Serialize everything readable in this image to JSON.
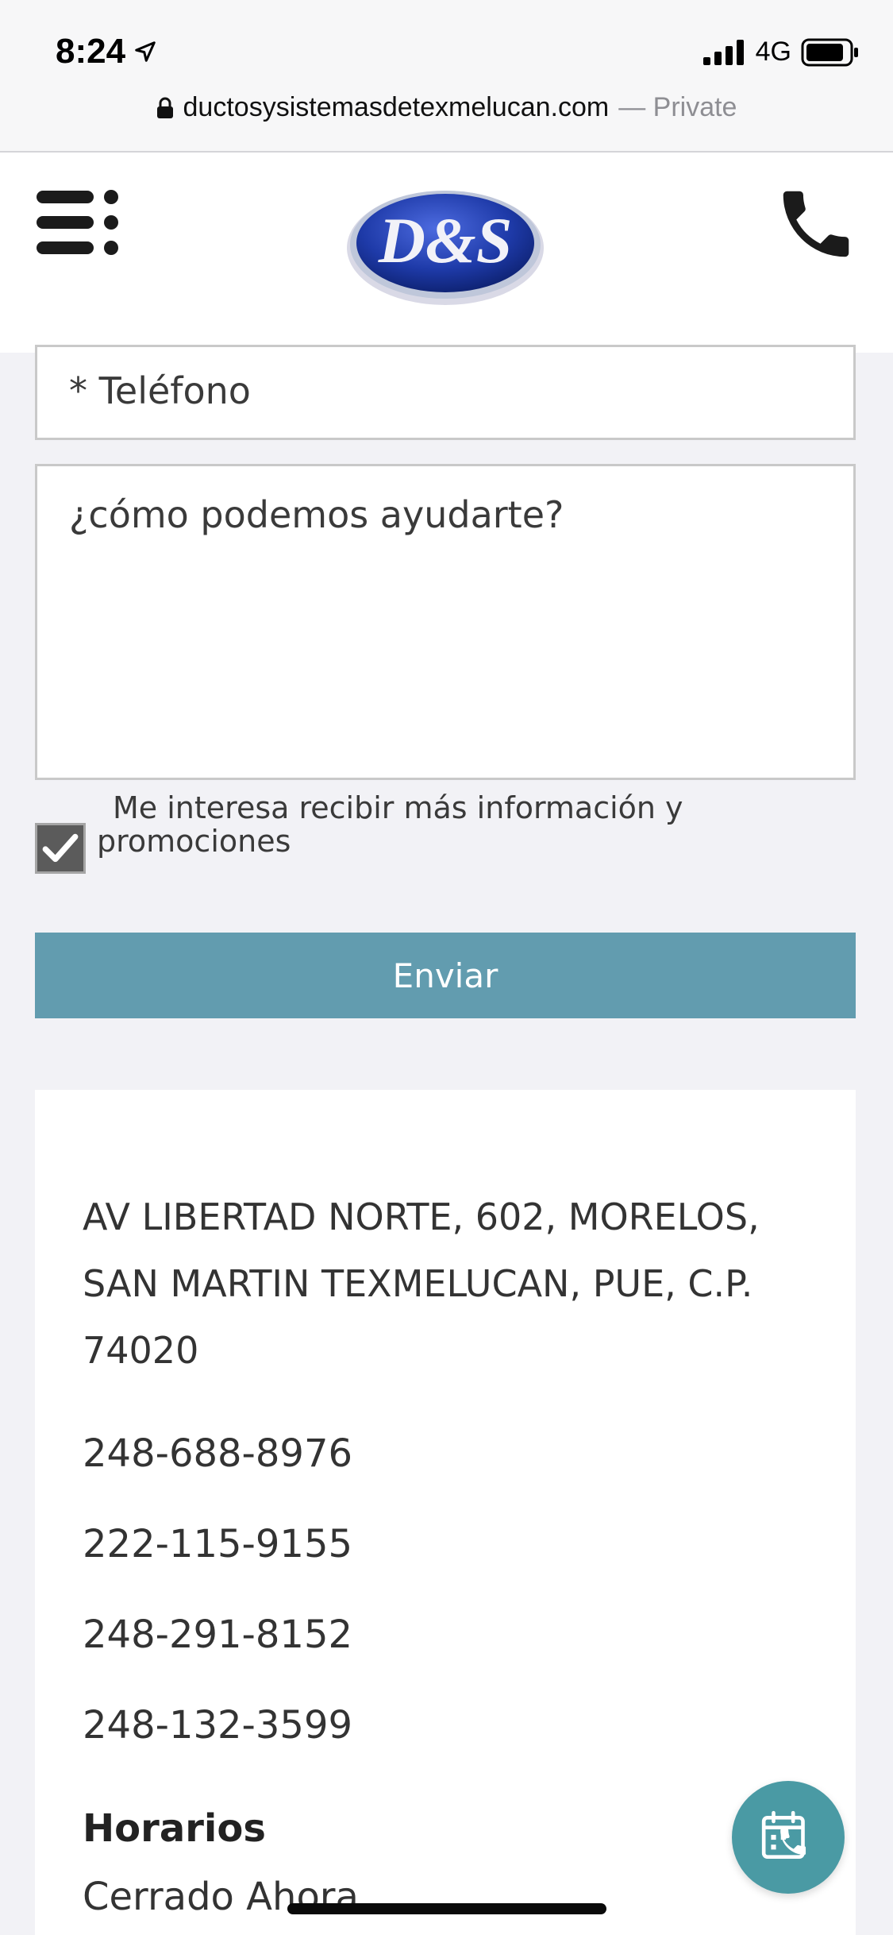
{
  "status_bar": {
    "time": "8:24",
    "network": "4G"
  },
  "url_bar": {
    "domain": "ductosysistemasdetexmelucan.com",
    "mode": "— Private"
  },
  "header": {
    "logo_text": "D&S",
    "icons": [
      "menu-icon",
      "phone-icon"
    ]
  },
  "form": {
    "phone_placeholder": "* Teléfono",
    "message_placeholder": "¿cómo podemos ayudarte?",
    "consent_label": "Me interesa recibir más información y promociones",
    "consent_checked": true,
    "submit_label": "Enviar"
  },
  "contact": {
    "address": "AV LIBERTAD NORTE, 602, MORELOS, SAN MARTIN TEXMELUCAN, PUE, C.P. 74020",
    "phones": [
      "248-688-8976",
      "222-115-9155",
      "248-291-8152",
      "248-132-3599"
    ],
    "hours_title": "Horarios",
    "hours_status": "Cerrado Ahora"
  },
  "colors": {
    "accent": "#629caf",
    "fab": "#4a9aa4",
    "background": "#f2f2f6"
  }
}
